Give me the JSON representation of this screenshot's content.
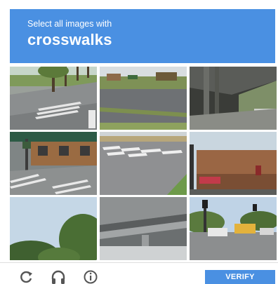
{
  "challenge": {
    "instruction": "Select all images with",
    "target": "crosswalks",
    "header_color": "#4a90e2"
  },
  "grid": {
    "rows": 3,
    "cols": 3,
    "tiles": [
      {
        "scene": "street-with-crosswalk-and-trees"
      },
      {
        "scene": "road-with-grass-median"
      },
      {
        "scene": "bridge-underside"
      },
      {
        "scene": "storefront-corner-with-crosswalk"
      },
      {
        "scene": "crosswalk-markings-on-road"
      },
      {
        "scene": "brick-building-with-sign"
      },
      {
        "scene": "trees-and-sky"
      },
      {
        "scene": "overpass-underside"
      },
      {
        "scene": "intersection-with-traffic-light-and-bus"
      }
    ]
  },
  "footer": {
    "reload_icon": "reload-icon",
    "audio_icon": "headphones-icon",
    "info_icon": "info-icon",
    "verify_label": "VERIFY"
  }
}
